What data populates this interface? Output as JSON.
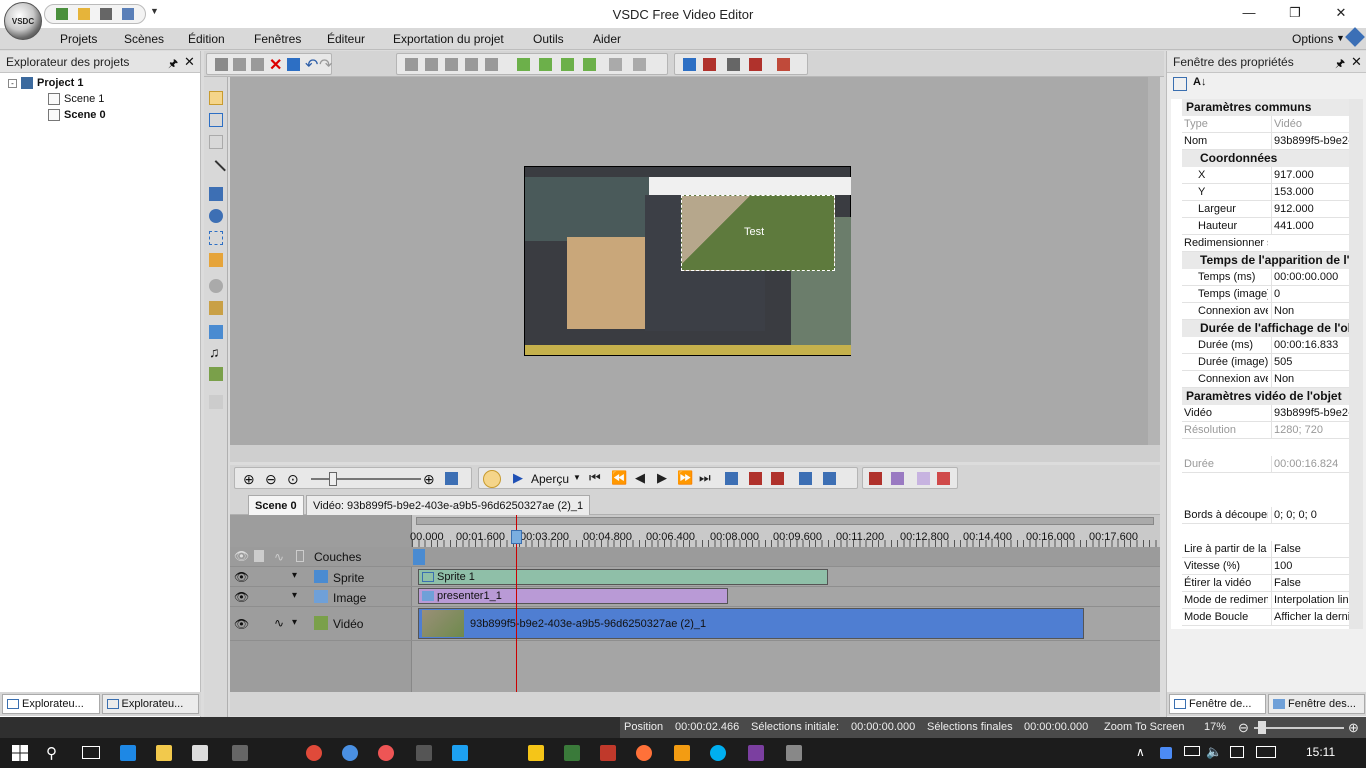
{
  "window": {
    "title": "VSDC Free Video Editor",
    "minimize": "—",
    "restore": "❐",
    "close": "✕"
  },
  "menu": {
    "items": [
      "Projets",
      "Scènes",
      "Édition",
      "Fenêtres",
      "Éditeur",
      "Exportation du projet",
      "Outils",
      "Aider"
    ],
    "options": "Options"
  },
  "explorer": {
    "title": "Explorateur des projets",
    "project": "Project 1",
    "scenes": [
      "Scene 1",
      "Scene 0"
    ],
    "tabs": [
      "Explorateu...",
      "Explorateu..."
    ]
  },
  "canvas": {
    "overlay_text": "Test"
  },
  "timeline": {
    "preview_label": "Aperçu",
    "tabs": [
      "Scene 0",
      "Vidéo: 93b899f5-b9e2-403e-a9b5-96d6250327ae (2)_1"
    ],
    "ruler": [
      "00.000",
      "00:01.600",
      "00:03.200",
      "00:04.800",
      "00:06.400",
      "00:08.000",
      "00:09.600",
      "00:11.200",
      "00:12.800",
      "00:14.400",
      "00:16.000",
      "00:17.600"
    ],
    "layers_label": "Couches",
    "tracks": [
      {
        "name": "Sprite",
        "clip": "Sprite 1",
        "color": "#8fbfa8"
      },
      {
        "name": "Image",
        "clip": "presenter1_1",
        "color": "#b99ad6"
      },
      {
        "name": "Vidéo",
        "clip": "93b899f5-b9e2-403e-a9b5-96d6250327ae (2)_1",
        "color": "#4f7ed2"
      }
    ]
  },
  "properties": {
    "title": "Fenêtre des propriétés",
    "sections": {
      "common": "Paramètres communs",
      "coords": "Coordonnées",
      "appear": "Temps de l'apparition de l'o",
      "duration": "Durée de l'affichage de l'ob",
      "video": "Paramètres vidéo de l'objet"
    },
    "rows": {
      "type": [
        "Type",
        "Vidéo"
      ],
      "name": [
        "Nom",
        "93b899f5-b9e2-"
      ],
      "x": [
        "X",
        "917.000"
      ],
      "y": [
        "Y",
        "153.000"
      ],
      "width": [
        "Largeur",
        "912.000"
      ],
      "height": [
        "Hauteur",
        "441.000"
      ],
      "resize": [
        "Redimensionner s",
        ""
      ],
      "time_ms": [
        "Temps (ms)",
        "00:00:00.000"
      ],
      "time_frame": [
        "Temps (image)",
        "0"
      ],
      "link1": [
        "Connexion ave",
        "Non"
      ],
      "dur_ms": [
        "Durée (ms)",
        "00:00:16.833"
      ],
      "dur_frame": [
        "Durée (image)",
        "505"
      ],
      "link2": [
        "Connexion ave",
        "Non"
      ],
      "video": [
        "Vidéo",
        "93b899f5-b9e2-"
      ],
      "resolution": [
        "Résolution",
        "1280; 720"
      ],
      "duration": [
        "Durée",
        "00:00:16.824"
      ],
      "crop": [
        "Bords à découper",
        "0; 0; 0; 0"
      ],
      "reverse": [
        "Lire à partir de la",
        "False"
      ],
      "speed": [
        "Vitesse (%)",
        "100"
      ],
      "stretch": [
        "Étirer la vidéo",
        "False"
      ],
      "resize_mode": [
        "Mode de redimen",
        "Interpolation line"
      ],
      "loop": [
        "Mode Boucle",
        "Afficher la derni"
      ]
    },
    "tabs": [
      "Fenêtre de...",
      "Fenêtre des..."
    ]
  },
  "status": {
    "position_label": "Position",
    "position": "00:00:02.466",
    "sel_start_label": "Sélections initiale:",
    "sel_start": "00:00:00.000",
    "sel_end_label": "Sélections finales",
    "sel_end": "00:00:00.000",
    "zoom_mode": "Zoom To Screen",
    "zoom": "17%"
  },
  "taskbar": {
    "time": "15:11"
  }
}
